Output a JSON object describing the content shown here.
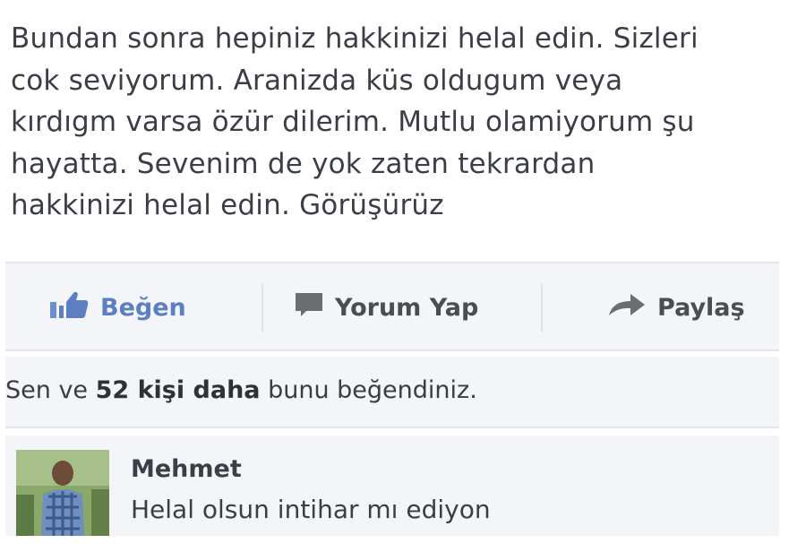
{
  "post": {
    "lines": [
      "Bundan sonra hepiniz hakkinizi helal edin. Sizleri",
      "cok seviyorum. Aranizda küs oldugum veya",
      "kırdıgm varsa özür dilerim. Mutlu olamiyorum şu",
      "hayatta. Sevenim de yok zaten tekrardan",
      "hakkinizi helal edin. Görüşürüz"
    ]
  },
  "actions": {
    "like_label": "Beğen",
    "comment_label": "Yorum Yap",
    "share_label": "Paylaş"
  },
  "likes": {
    "prefix": "Sen ve ",
    "count_text": "52 kişi daha",
    "suffix": " bunu beğendiniz."
  },
  "comment": {
    "author": "Mehmet",
    "text": "Helal olsun intihar mı ediyon"
  },
  "icons": {
    "like": "thumbs-up-icon",
    "comment": "speech-bubble-icon",
    "share": "share-arrow-icon"
  },
  "colors": {
    "like_accent": "#5b7fc2",
    "bar_background": "#f4f5f8"
  }
}
